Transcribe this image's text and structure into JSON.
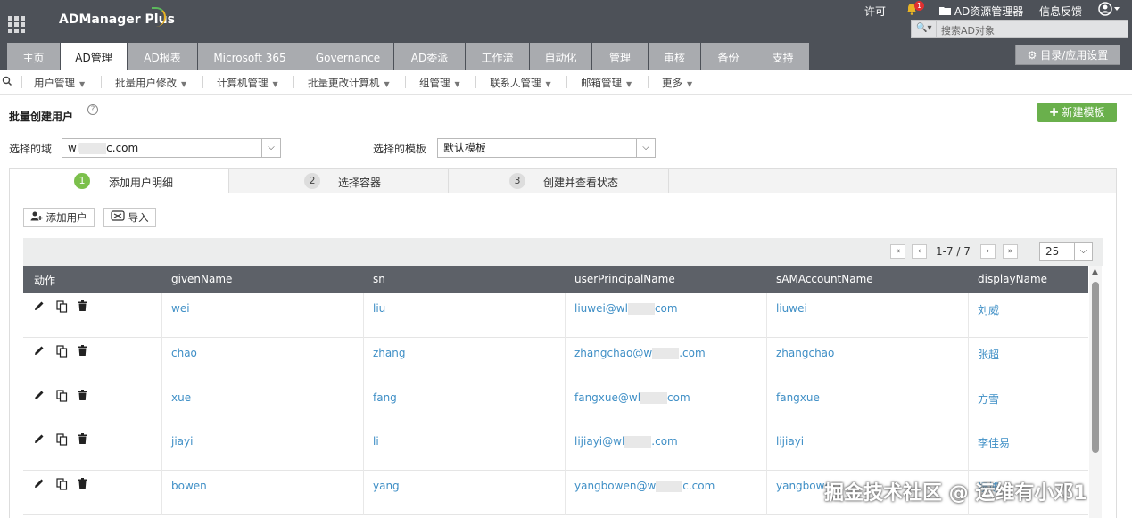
{
  "app": {
    "logo": "ADManager Plus"
  },
  "topbar": {
    "license": "许可",
    "notification_count": "1",
    "ad_explorer": "AD资源管理器",
    "feedback": "信息反馈",
    "search_placeholder": "搜索AD对象"
  },
  "tabs": [
    "主页",
    "AD管理",
    "AD报表",
    "Microsoft 365",
    "Governance",
    "AD委派",
    "工作流",
    "自动化",
    "管理",
    "审核",
    "备份",
    "支持"
  ],
  "active_tab": "AD管理",
  "directory_button": "目录/应用设置",
  "subnav": [
    "用户管理",
    "批量用户修改",
    "计算机管理",
    "批量更改计算机",
    "组管理",
    "联系人管理",
    "邮箱管理",
    "更多"
  ],
  "page": {
    "title": "批量创建用户",
    "new_template_button": "新建模板",
    "domain_label": "选择的域",
    "domain_value_prefix": "wl",
    "domain_value_suffix": "c.com",
    "template_label": "选择的模板",
    "template_value": "默认模板"
  },
  "steps": [
    {
      "num": "1",
      "label": "添加用户明细"
    },
    {
      "num": "2",
      "label": "选择容器"
    },
    {
      "num": "3",
      "label": "创建并查看状态"
    }
  ],
  "toolbar": {
    "add_user": "添加用户",
    "import": "导入"
  },
  "pager": {
    "range": "1-7 / 7",
    "page_size": "25"
  },
  "table": {
    "headers": [
      "动作",
      "givenName",
      "sn",
      "userPrincipalName",
      "sAMAccountName",
      "displayName"
    ],
    "rows": [
      {
        "givenName": "wei",
        "sn": "liu",
        "upn_prefix": "liuwei@wl",
        "upn_suffix": "com",
        "sam": "liuwei",
        "display": "刘威"
      },
      {
        "givenName": "chao",
        "sn": "zhang",
        "upn_prefix": "zhangchao@w",
        "upn_suffix": ".com",
        "sam": "zhangchao",
        "display": "张超"
      },
      {
        "givenName": "xue",
        "sn": "fang",
        "upn_prefix": "fangxue@wl",
        "upn_suffix": "com",
        "sam": "fangxue",
        "display": "方雪"
      },
      {
        "givenName": "jiayi",
        "sn": "li",
        "upn_prefix": "lijiayi@wl",
        "upn_suffix": ".com",
        "sam": "lijiayi",
        "display": "李佳易"
      },
      {
        "givenName": "bowen",
        "sn": "yang",
        "upn_prefix": "yangbowen@w",
        "upn_suffix": "c.com",
        "sam": "yangbowe",
        "display": "杨博"
      }
    ]
  },
  "watermark": "掘金技术社区 @ 运维有小邓1"
}
